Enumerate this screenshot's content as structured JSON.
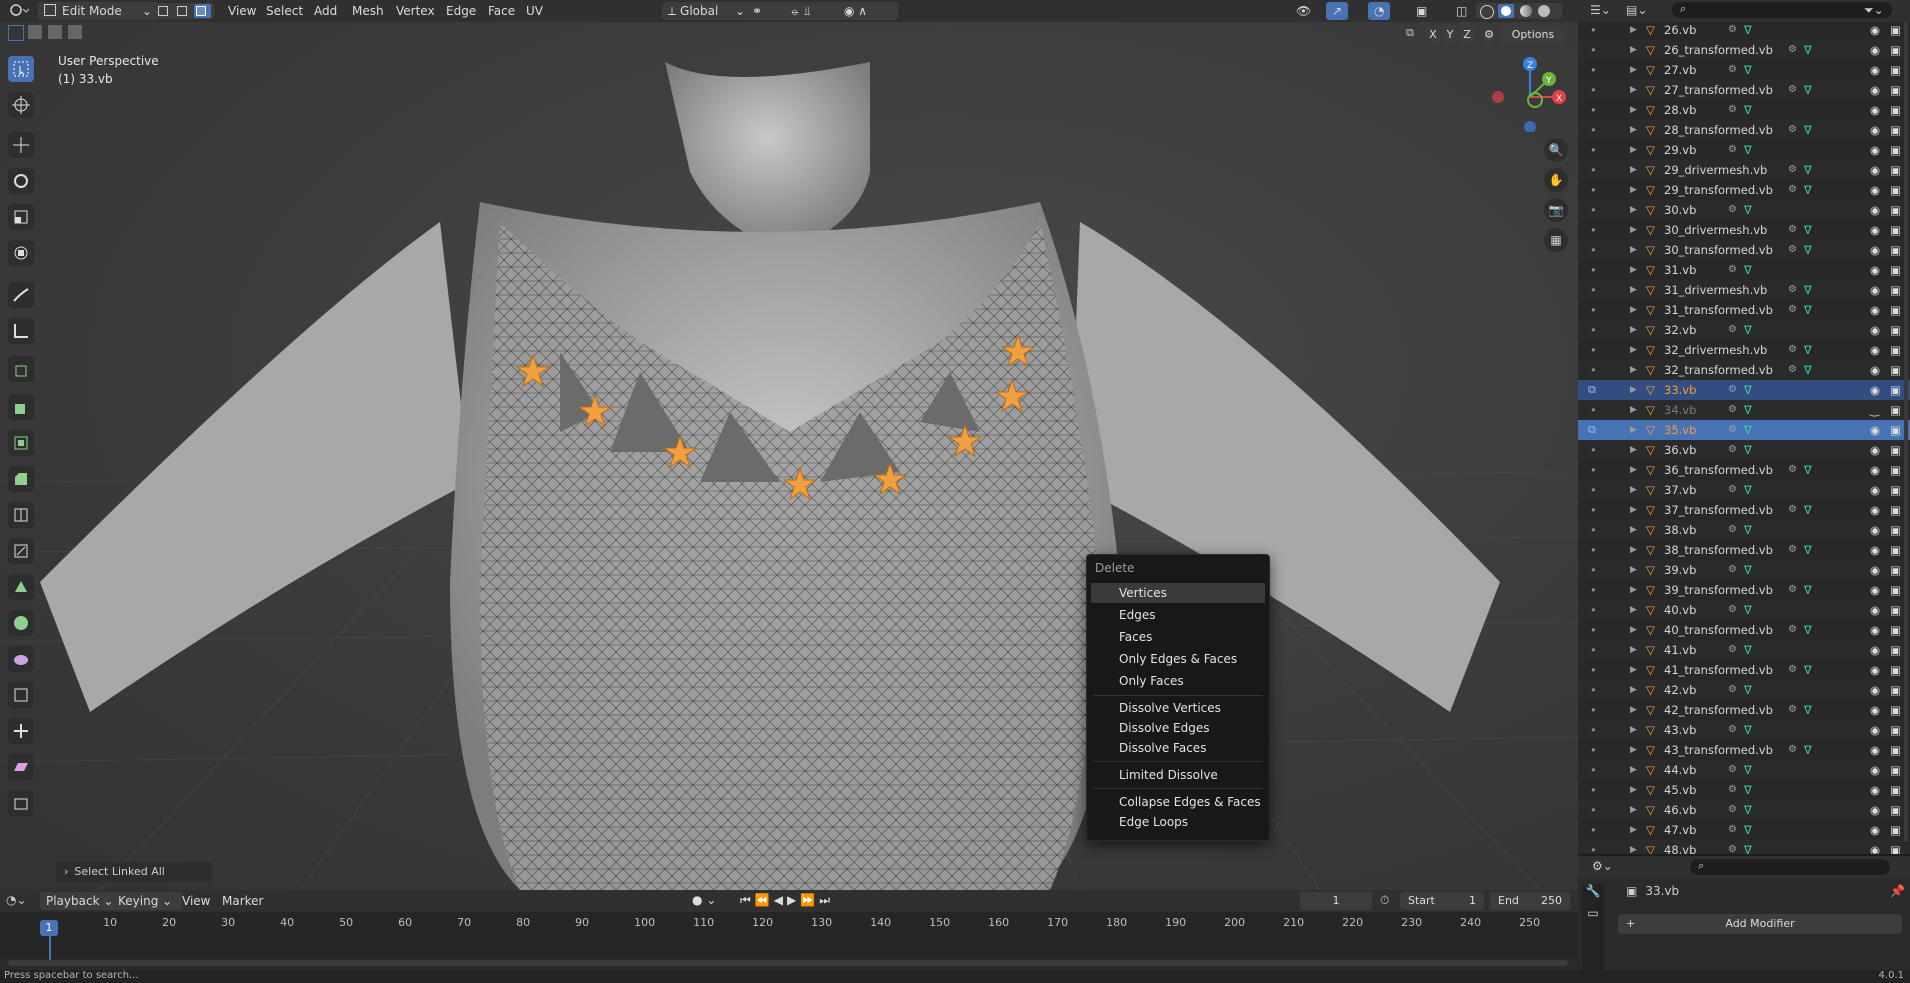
{
  "header": {
    "mode": "Edit Mode",
    "menus": [
      "View",
      "Select",
      "Add",
      "Mesh",
      "Vertex",
      "Edge",
      "Face",
      "UV"
    ],
    "transform_orientation": "Global",
    "options_label": "Options",
    "axes": [
      "X",
      "Y",
      "Z"
    ]
  },
  "viewport": {
    "perspective_label": "User Perspective",
    "object_label": "(1) 33.vb",
    "gizmo": {
      "z": "Z",
      "y": "Y",
      "x": "X"
    },
    "last_operator": "Select Linked All"
  },
  "delete_menu": {
    "title": "Delete",
    "groups": [
      [
        "Vertices",
        "Edges",
        "Faces",
        "Only Edges & Faces",
        "Only Faces"
      ],
      [
        "Dissolve Vertices",
        "Dissolve Edges",
        "Dissolve Faces"
      ],
      [
        "Limited Dissolve"
      ],
      [
        "Collapse Edges & Faces",
        "Edge Loops"
      ]
    ],
    "highlighted": "Vertices"
  },
  "outliner": {
    "items": [
      {
        "name": "26.vb",
        "state": "normal"
      },
      {
        "name": "26_transformed.vb",
        "state": "normal"
      },
      {
        "name": "27.vb",
        "state": "normal"
      },
      {
        "name": "27_transformed.vb",
        "state": "normal"
      },
      {
        "name": "28.vb",
        "state": "normal"
      },
      {
        "name": "28_transformed.vb",
        "state": "normal"
      },
      {
        "name": "29.vb",
        "state": "normal"
      },
      {
        "name": "29_drivermesh.vb",
        "state": "normal"
      },
      {
        "name": "29_transformed.vb",
        "state": "normal"
      },
      {
        "name": "30.vb",
        "state": "normal"
      },
      {
        "name": "30_drivermesh.vb",
        "state": "normal"
      },
      {
        "name": "30_transformed.vb",
        "state": "normal"
      },
      {
        "name": "31.vb",
        "state": "normal"
      },
      {
        "name": "31_drivermesh.vb",
        "state": "normal"
      },
      {
        "name": "31_transformed.vb",
        "state": "normal"
      },
      {
        "name": "32.vb",
        "state": "normal"
      },
      {
        "name": "32_drivermesh.vb",
        "state": "normal"
      },
      {
        "name": "32_transformed.vb",
        "state": "normal"
      },
      {
        "name": "33.vb",
        "state": "selected"
      },
      {
        "name": "34.vb",
        "state": "hidden"
      },
      {
        "name": "35.vb",
        "state": "active"
      },
      {
        "name": "36.vb",
        "state": "normal"
      },
      {
        "name": "36_transformed.vb",
        "state": "normal"
      },
      {
        "name": "37.vb",
        "state": "normal"
      },
      {
        "name": "37_transformed.vb",
        "state": "normal"
      },
      {
        "name": "38.vb",
        "state": "normal"
      },
      {
        "name": "38_transformed.vb",
        "state": "normal"
      },
      {
        "name": "39.vb",
        "state": "normal"
      },
      {
        "name": "39_transformed.vb",
        "state": "normal"
      },
      {
        "name": "40.vb",
        "state": "normal"
      },
      {
        "name": "40_transformed.vb",
        "state": "normal"
      },
      {
        "name": "41.vb",
        "state": "normal"
      },
      {
        "name": "41_transformed.vb",
        "state": "normal"
      },
      {
        "name": "42.vb",
        "state": "normal"
      },
      {
        "name": "42_transformed.vb",
        "state": "normal"
      },
      {
        "name": "43.vb",
        "state": "normal"
      },
      {
        "name": "43_transformed.vb",
        "state": "normal"
      },
      {
        "name": "44.vb",
        "state": "normal"
      },
      {
        "name": "45.vb",
        "state": "normal"
      },
      {
        "name": "46.vb",
        "state": "normal"
      },
      {
        "name": "47.vb",
        "state": "normal"
      },
      {
        "name": "48.vb",
        "state": "normal"
      }
    ]
  },
  "properties": {
    "object_name": "33.vb",
    "add_modifier": "Add Modifier"
  },
  "timeline": {
    "menus": [
      "Playback",
      "Keying",
      "View",
      "Marker"
    ],
    "current_frame": "1",
    "start_label": "Start",
    "start": "1",
    "end_label": "End",
    "end": "250",
    "ticks": [
      "1",
      "10",
      "20",
      "30",
      "40",
      "50",
      "60",
      "70",
      "80",
      "90",
      "100",
      "110",
      "120",
      "130",
      "140",
      "150",
      "160",
      "170",
      "180",
      "190",
      "200",
      "210",
      "220",
      "230",
      "240",
      "250"
    ]
  },
  "status": {
    "hint": "Press spacebar to search...",
    "version": "4.0.1"
  },
  "colors": {
    "accent": "#4772b3",
    "selected_row": "#334d80",
    "seam_vertex": "#f0a040",
    "hidden_row_text": "#7a7a7a",
    "active_row_text": "#ff9a3c"
  }
}
